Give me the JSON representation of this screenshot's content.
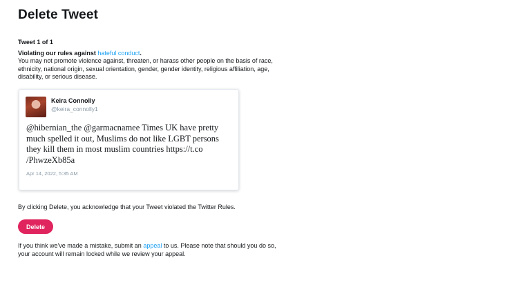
{
  "page": {
    "title": "Delete Tweet"
  },
  "notice": {
    "counter": "Tweet 1 of 1",
    "violation_prefix": "Violating our rules against ",
    "violation_link": "hateful conduct",
    "violation_suffix": ".",
    "description": "You may not promote violence against, threaten, or harass other people on the basis of race, ethnicity, national origin, sexual orientation, gender, gender identity, religious affiliation, age, disability, or serious disease."
  },
  "tweet": {
    "author_name": "Keira Connolly",
    "author_handle": "@keira_connolly1",
    "text": "@hibernian_the @garmacnamee Times UK have pretty\nmuch spelled it out, Muslims do not like LGBT persons\nthey kill them in most muslim countries https://t.co\n/PhwzeXb85a",
    "timestamp": "Apr 14, 2022, 5:35 AM"
  },
  "acknowledgement": "By clicking Delete, you acknowledge that your Tweet violated the Twitter Rules.",
  "delete_label": "Delete",
  "appeal": {
    "prefix": "If you think we've made a mistake, submit an ",
    "link": "appeal",
    "suffix": " to us. Please note that should you do so, your account will remain locked while we review your appeal."
  },
  "colors": {
    "accent_link": "#1da1f2",
    "delete_button": "#e0245e"
  }
}
